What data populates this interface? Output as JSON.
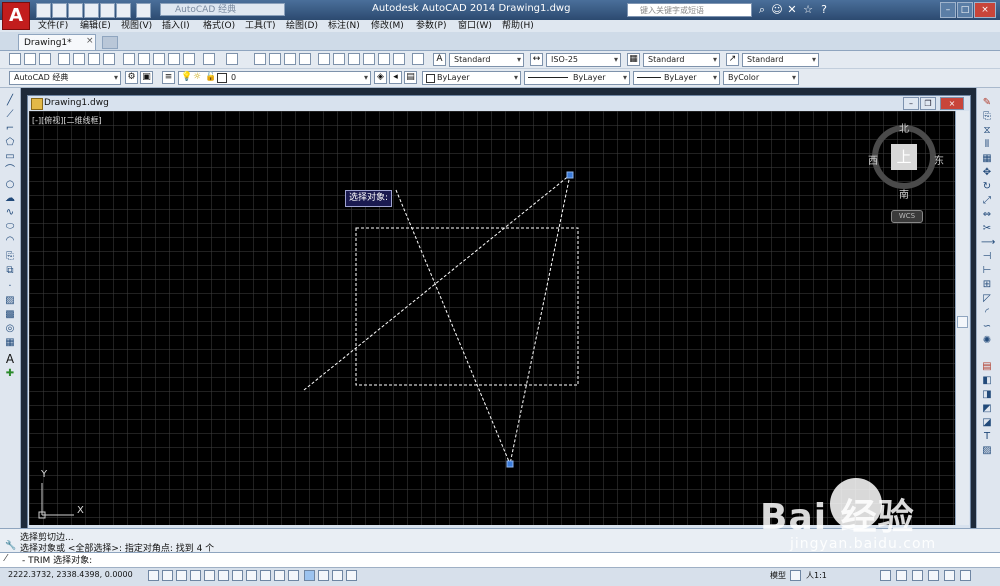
{
  "window": {
    "title": "Autodesk AutoCAD 2014    Drawing1.dwg",
    "app_logo": "A",
    "workspace_select": "AutoCAD 经典",
    "search_placeholder": "键入关键字或短语"
  },
  "menubar": {
    "items": [
      {
        "label": "文件(F)"
      },
      {
        "label": "编辑(E)"
      },
      {
        "label": "视图(V)"
      },
      {
        "label": "插入(I)"
      },
      {
        "label": "格式(O)"
      },
      {
        "label": "工具(T)"
      },
      {
        "label": "绘图(D)"
      },
      {
        "label": "标注(N)"
      },
      {
        "label": "修改(M)"
      },
      {
        "label": "参数(P)"
      },
      {
        "label": "窗口(W)"
      },
      {
        "label": "帮助(H)"
      }
    ]
  },
  "tabs": {
    "active": "Drawing1*",
    "close_symbol": "×"
  },
  "styles_toolbar": {
    "text_style": "Standard",
    "dim_style": "ISO-25",
    "table_style": "Standard",
    "mleader_style": "Standard"
  },
  "layers_toolbar": {
    "workspace": "AutoCAD 经典",
    "layer_name": "0",
    "color": "ByLayer",
    "linetype": "ByLayer",
    "lineweight": "ByLayer",
    "plot_style": "ByColor"
  },
  "drawing_window": {
    "title": "Drawing1.dwg",
    "viewport_label": "[-][俯视][二维线框]",
    "prompt_tip": "选择对象:",
    "viewcube": {
      "top": "上",
      "north": "北",
      "south": "南",
      "east": "东",
      "west": "西",
      "wcs": "WCS"
    },
    "ucs": {
      "x": "X",
      "y": "Y"
    }
  },
  "command": {
    "history": [
      "选择剪切边...",
      "选择对象或 <全部选择>: 指定对角点: 找到 4 个"
    ],
    "prompt": "- TRIM 选择对象:"
  },
  "status": {
    "coords": "2222.3732,  2338.4398,  0.0000",
    "model": "模型",
    "scale": "人1:1"
  },
  "watermark": {
    "logo": "Bai 经验",
    "url": "jingyan.baidu.com"
  },
  "colors": {
    "canvas": "#000000",
    "dashed_line": "#ffffff",
    "grip": "#3b7bd8",
    "chrome": "#dfe7f0"
  }
}
